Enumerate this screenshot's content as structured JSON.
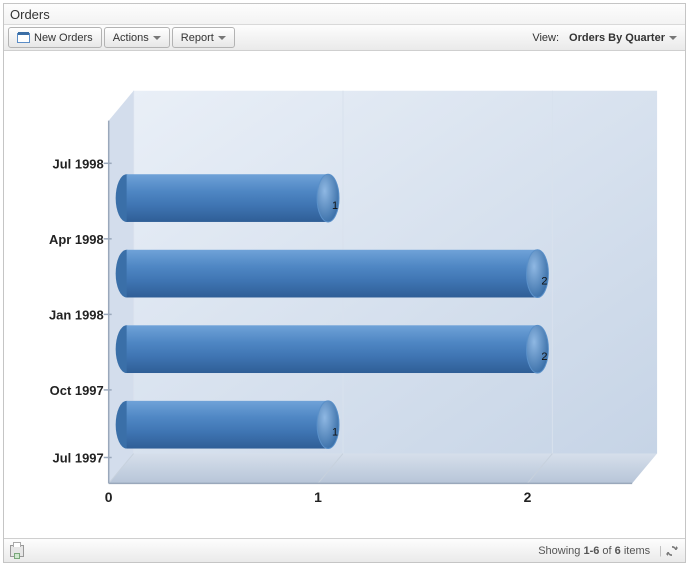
{
  "header": {
    "title": "Orders"
  },
  "toolbar": {
    "new_label": "New Orders",
    "actions_label": "Actions",
    "report_label": "Report",
    "view_label": "View:",
    "view_selected": "Orders By Quarter"
  },
  "footer": {
    "summary_prefix": "Showing ",
    "summary_range": "1-6",
    "summary_mid": " of ",
    "summary_total": "6",
    "summary_suffix": " items"
  },
  "chart_data": {
    "type": "bar",
    "orientation": "horizontal",
    "categories": [
      "Jul 1997",
      "Oct 1997",
      "Jan 1998",
      "Apr 1998",
      "Jul 1998"
    ],
    "values": [
      null,
      1,
      2,
      2,
      1
    ],
    "data_labels": [
      "",
      "1",
      "2",
      "2",
      "1"
    ],
    "xlabel": "",
    "ylabel": "",
    "x_ticks": [
      0,
      1,
      2
    ],
    "xlim": [
      0,
      2.5
    ],
    "title": ""
  }
}
